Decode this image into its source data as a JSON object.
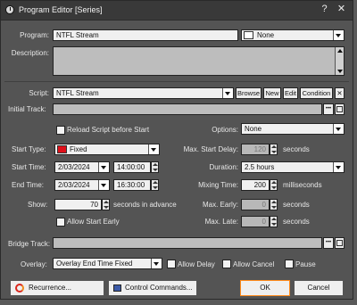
{
  "window": {
    "title": "Program Editor [Series]",
    "help": "?",
    "close": "✕"
  },
  "labels": {
    "program": "Program:",
    "description": "Description:",
    "script": "Script:",
    "initial_track": "Initial Track:",
    "options": "Options:",
    "start_type": "Start Type:",
    "start_time": "Start Time:",
    "end_time": "End Time:",
    "show": "Show:",
    "max_start_delay": "Max. Start Delay:",
    "duration": "Duration:",
    "mixing_time": "Mixing Time:",
    "max_early": "Max. Early:",
    "max_late": "Max. Late:",
    "bridge_track": "Bridge Track:",
    "overlay": "Overlay:",
    "seconds": "seconds",
    "milliseconds": "milliseconds",
    "seconds_in_advance": "seconds in advance"
  },
  "program": {
    "value": "NTFL Stream",
    "color_label": "None",
    "color": "#ffffff"
  },
  "description": {
    "value": ""
  },
  "script": {
    "value": "NTFL Stream",
    "browse": "Browse",
    "new": "New",
    "edit": "Edit",
    "condition": "Condition",
    "clear": "✕"
  },
  "initial_track": {
    "value": "",
    "more": "•••"
  },
  "reload_script": {
    "label": "Reload Script before Start",
    "checked": false
  },
  "options": {
    "value": "None"
  },
  "start_type": {
    "value": "Fixed",
    "color": "#e0101a"
  },
  "start_time": {
    "date": "2/03/2024",
    "time": "14:00:00"
  },
  "end_time": {
    "date": "2/03/2024",
    "time": "16:30:00"
  },
  "show": {
    "value": "70"
  },
  "allow_start_early": {
    "label": "Allow Start Early",
    "checked": false
  },
  "max_start_delay": {
    "value": "120"
  },
  "duration": {
    "value": "2.5 hours"
  },
  "mixing_time": {
    "value": "200"
  },
  "max_early": {
    "value": "0"
  },
  "max_late": {
    "value": "0"
  },
  "bridge_track": {
    "value": "",
    "more": "•••"
  },
  "overlay": {
    "value": "Overlay End Time Fixed"
  },
  "allow_delay": {
    "label": "Allow Delay",
    "checked": false
  },
  "allow_cancel": {
    "label": "Allow Cancel",
    "checked": false
  },
  "pause": {
    "label": "Pause",
    "checked": false
  },
  "buttons": {
    "recurrence": "Recurrence...",
    "control_commands": "Control Commands...",
    "ok": "OK",
    "cancel": "Cancel"
  }
}
